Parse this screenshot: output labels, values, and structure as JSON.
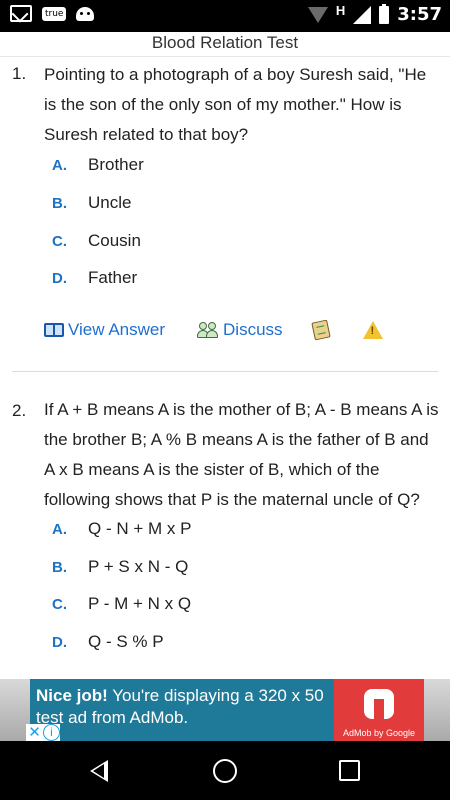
{
  "status_bar": {
    "time": "3:57",
    "network_label": "H",
    "notification_badge": "true",
    "icons": [
      "gmail-icon",
      "true-app-icon",
      "android-icon",
      "wifi-icon",
      "signal-icon",
      "battery-icon"
    ]
  },
  "page": {
    "title": "Blood Relation Test"
  },
  "questions": [
    {
      "number": "1.",
      "text": "Pointing to a photograph of a boy Suresh said, \"He is the son of the only son of my mother.\" How is Suresh related to that boy?",
      "options": [
        {
          "letter": "A.",
          "text": "Brother"
        },
        {
          "letter": "B.",
          "text": "Uncle"
        },
        {
          "letter": "C.",
          "text": "Cousin"
        },
        {
          "letter": "D.",
          "text": "Father"
        }
      ],
      "actions": {
        "view_answer": "View Answer",
        "discuss": "Discuss"
      }
    },
    {
      "number": "2.",
      "text": "If A + B means A is the mother of B; A - B means A is the brother B; A % B means A is the father of B and A x B means A is the sister of B, which of the following shows that P is the maternal uncle of Q?",
      "options": [
        {
          "letter": "A.",
          "text": "Q - N + M x P"
        },
        {
          "letter": "B.",
          "text": "P + S x N - Q"
        },
        {
          "letter": "C.",
          "text": "P - M + N x Q"
        },
        {
          "letter": "D.",
          "text": "Q - S % P"
        }
      ]
    }
  ],
  "ad": {
    "headline": "Nice job!",
    "body": " You're displaying a 320 x 50 test ad from AdMob.",
    "brand": "AdMob by Google",
    "close_glyph": "✕",
    "info_glyph": "i"
  },
  "colors": {
    "accent_blue": "#1f72c4",
    "ad_background": "#1f7a99",
    "ad_red": "#e23b3b"
  }
}
